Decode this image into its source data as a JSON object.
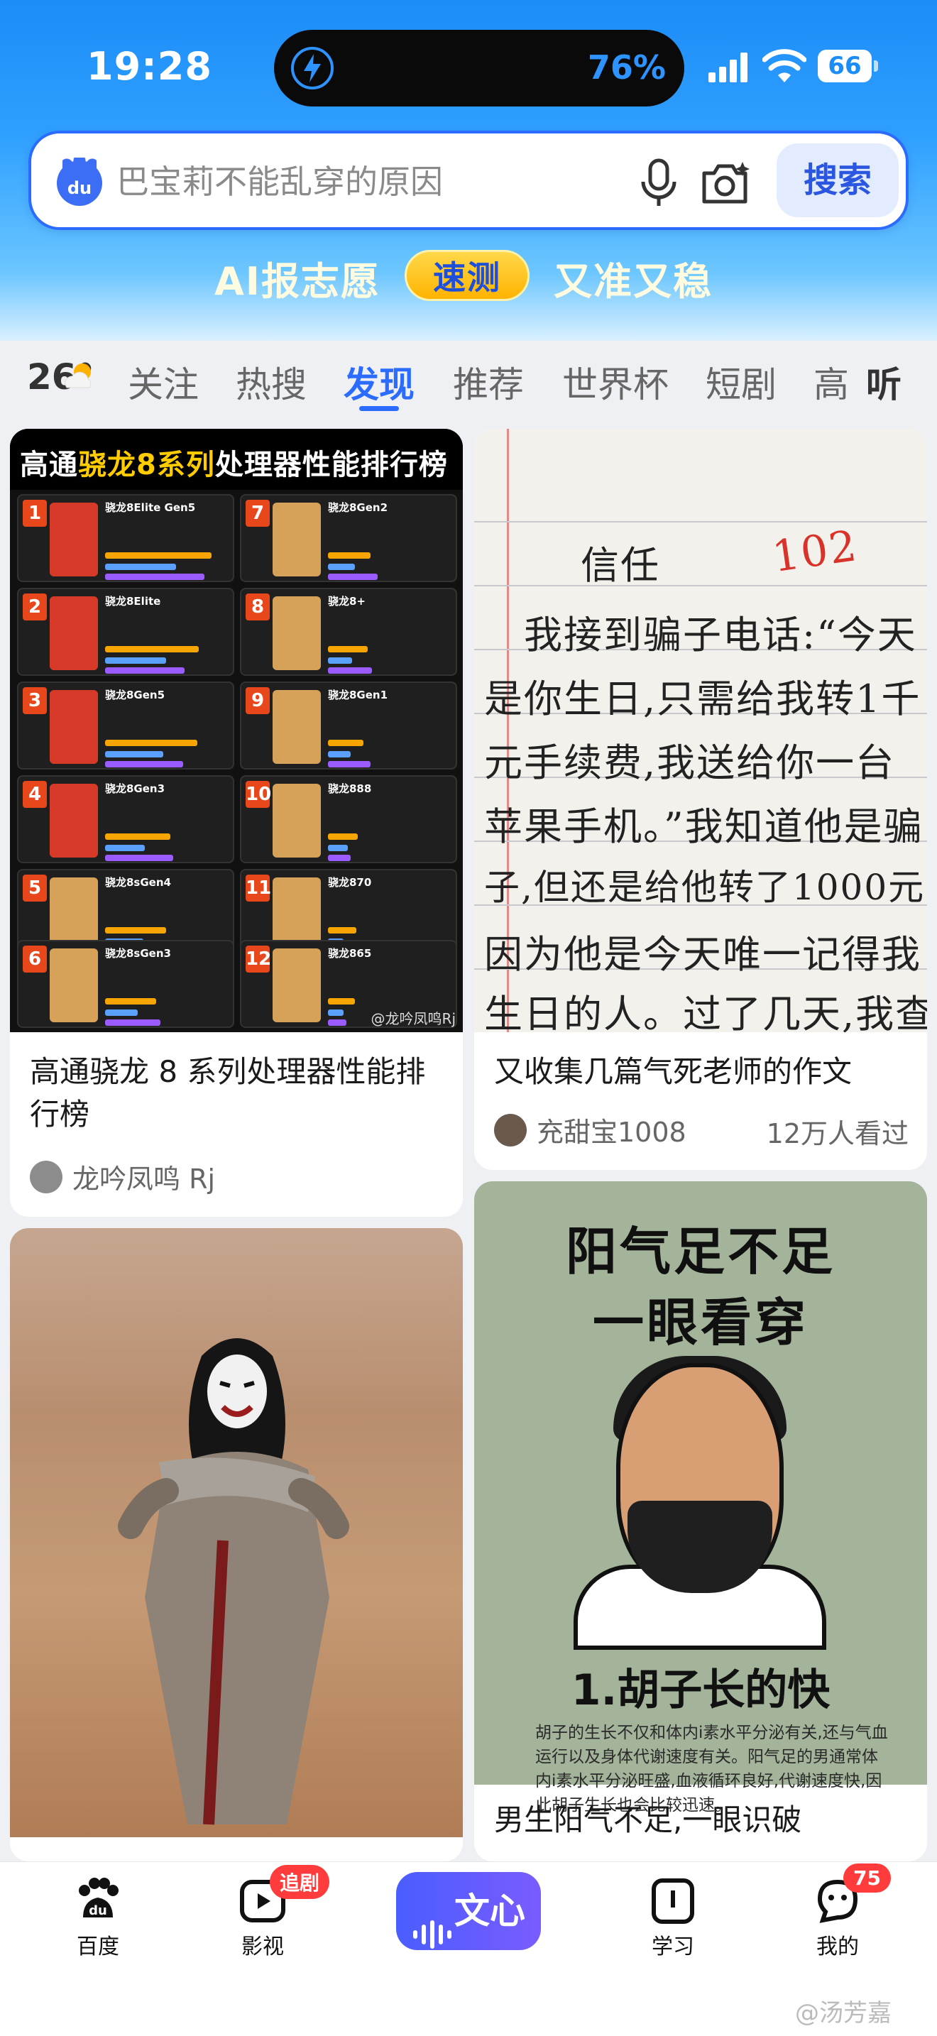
{
  "status": {
    "time": "19:28",
    "battery_pct": "76%",
    "battery_level": "66"
  },
  "search": {
    "query": "巴宝莉不能乱穿的原因",
    "button": "搜索",
    "logo": "du"
  },
  "banner": {
    "left": "AI报志愿",
    "pill": "速测",
    "right": "又准又稳"
  },
  "tabs": {
    "weather": "26°",
    "items": [
      "关注",
      "热搜",
      "发现",
      "推荐",
      "世界杯",
      "短剧",
      "高"
    ],
    "active": "发现",
    "listen": "听"
  },
  "cards": {
    "c1": {
      "header_a": "高通",
      "header_b": "骁龙8系列",
      "header_c": "处理器性能排行榜",
      "title": "高通骁龙 8 系列处理器性能排行榜",
      "author": "龙吟凤鸣 Rj",
      "watermark": "@龙吟凤鸣Rj",
      "ranks": [
        {
          "no": "1",
          "name": "骁龙8Elite Gen5"
        },
        {
          "no": "2",
          "name": "骁龙8Elite"
        },
        {
          "no": "3",
          "name": "骁龙8Gen5"
        },
        {
          "no": "4",
          "name": "骁龙8Gen3"
        },
        {
          "no": "5",
          "name": "骁龙8sGen4"
        },
        {
          "no": "6",
          "name": "骁龙8sGen3"
        },
        {
          "no": "7",
          "name": "骁龙8Gen2"
        },
        {
          "no": "8",
          "name": "骁龙8+"
        },
        {
          "no": "9",
          "name": "骁龙8Gen1"
        },
        {
          "no": "10",
          "name": "骁龙888"
        },
        {
          "no": "11",
          "name": "骁龙870"
        },
        {
          "no": "12",
          "name": "骁龙865"
        }
      ]
    },
    "c2": {
      "lines": [
        "信任",
        "我接到骗子电话:“今天",
        "是你生日,只需给我转1千",
        "元手续费,我送给你一台",
        "苹果手机。”我知道他是骗",
        "子,但还是给他转了1000元",
        "因为他是今天唯一记得我",
        "生日的人。过了几天,我查"
      ],
      "score": "102",
      "title": "又收集几篇气死老师的作文",
      "author": "充甜宝1008",
      "views": "12万人看过"
    },
    "c4": {
      "t1": "阳气足不足",
      "t2": "一眼看穿",
      "h2": "1.胡子长的快",
      "para": "胡子的生长不仅和体内i素水平分泌有关,还与气血运行以及身体代谢速度有关。阳气足的男通常体内i素水平分泌旺盛,血液循环良好,代谢速度快,因此胡子生长也会比较迅速。",
      "title": "男生阳气不足,一眼识破"
    }
  },
  "bottom_nav": {
    "home": "百度",
    "video": "影视",
    "video_badge": "追剧",
    "center": "文心",
    "study": "学习",
    "me": "我的",
    "me_badge": "75"
  },
  "watermark": "@汤芳嘉"
}
